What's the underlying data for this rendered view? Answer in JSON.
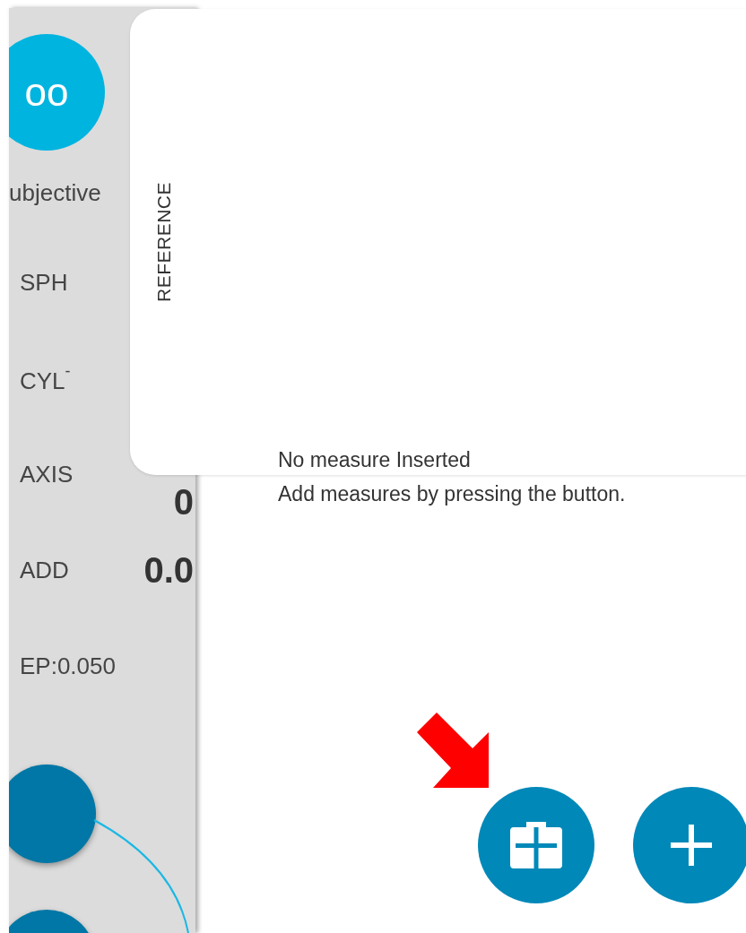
{
  "side_panel": {
    "mode_button": {
      "symbol": "oo"
    },
    "rows": [
      {
        "label": "ubjective"
      },
      {
        "label": "SPH"
      },
      {
        "label": "CYL$^{-}$"
      },
      {
        "label": "AXIS",
        "value": "0"
      },
      {
        "label": "ADD",
        "value": "0.0"
      },
      {
        "label": "EP:0.050"
      }
    ]
  },
  "reference_tab": {
    "label": "REFERENCE"
  },
  "empty_state": {
    "title": "No measure Inserted",
    "hint": "Add measures by pressing the button."
  }
}
